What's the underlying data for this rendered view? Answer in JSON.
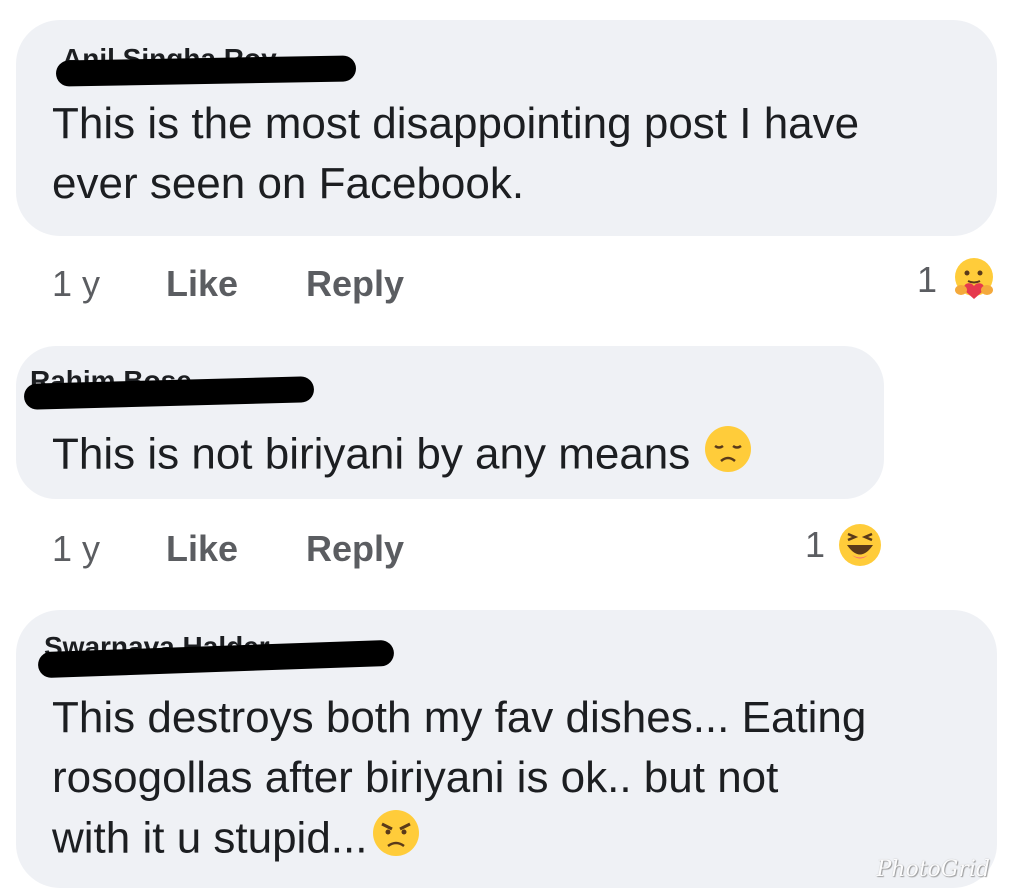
{
  "comments": [
    {
      "author": "Anil Singha Roy",
      "text": "This is the most disappointing post I have\never seen on Facebook.",
      "time": "1 y",
      "like_label": "Like",
      "reply_label": "Reply",
      "reaction_count": "1",
      "reaction_icon": "care-reaction-icon"
    },
    {
      "author": "Rahim Bose",
      "text": "This is not biriyani by any means",
      "inline_emoji": "disappointed-face-icon",
      "time": "1 y",
      "like_label": "Like",
      "reply_label": "Reply",
      "reaction_count": "1",
      "reaction_icon": "haha-reaction-icon"
    },
    {
      "author": "Swarnava Halder",
      "text": "This destroys both my fav dishes... Eating\nrosogollas after biriyani is ok.. but not\nwith it u stupid...",
      "inline_emoji": "angry-face-icon"
    }
  ],
  "watermark": "PhotoGrid",
  "colors": {
    "bubble": "#eff1f5",
    "text": "#1c1e21",
    "meta": "#5b5d61",
    "emoji_yellow": "#ffcc3a"
  }
}
